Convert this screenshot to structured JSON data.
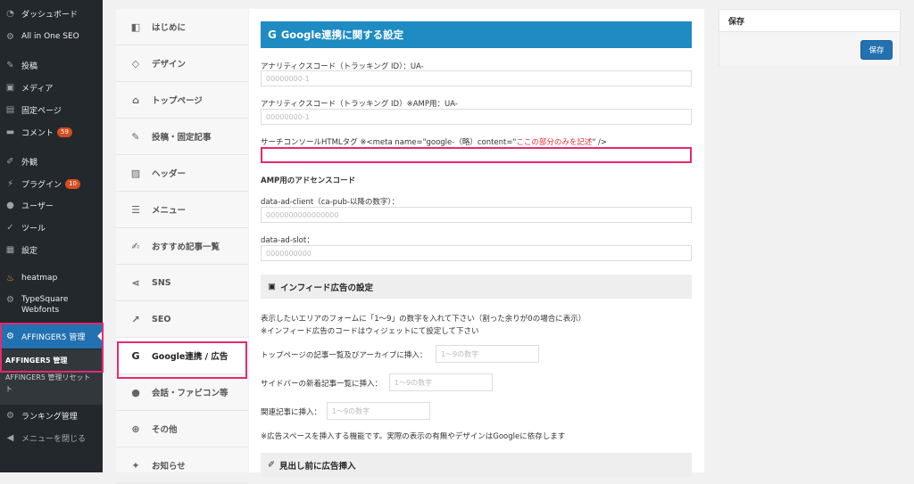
{
  "admin_menu": {
    "items": [
      {
        "label": "ダッシュボード",
        "icon": "dashboard-icon"
      },
      {
        "label": "All in One SEO",
        "icon": "gear-icon"
      },
      {
        "label": "投稿",
        "icon": "pin-icon"
      },
      {
        "label": "メディア",
        "icon": "media-icon"
      },
      {
        "label": "固定ページ",
        "icon": "page-icon"
      },
      {
        "label": "コメント",
        "icon": "comment-icon",
        "badge": "59"
      },
      {
        "label": "外観",
        "icon": "brush-icon"
      },
      {
        "label": "プラグイン",
        "icon": "plugin-icon",
        "badge": "10"
      },
      {
        "label": "ユーザー",
        "icon": "user-icon"
      },
      {
        "label": "ツール",
        "icon": "wrench-icon"
      },
      {
        "label": "設定",
        "icon": "settings-icon"
      },
      {
        "label": "heatmap",
        "icon": "heatmap-icon"
      },
      {
        "label": "TypeSquare",
        "label2": "Webfonts",
        "icon": "gear-icon"
      },
      {
        "label": "AFFINGER5 管理",
        "icon": "gear-icon"
      },
      {
        "label": "ランキング管理",
        "icon": "gear-icon"
      },
      {
        "label": "メニューを閉じる",
        "icon": "collapse-icon"
      }
    ],
    "submenu": {
      "item1": "AFFINGER5 管理",
      "item2": "AFFINGER5 管理リセット",
      "item2b": "ト"
    }
  },
  "tabs": [
    {
      "label": "はじめに",
      "icon": "book-icon"
    },
    {
      "label": "デザイン",
      "icon": "diamond-icon"
    },
    {
      "label": "トップページ",
      "icon": "home-icon"
    },
    {
      "label": "投稿・固定記事",
      "icon": "edit-icon"
    },
    {
      "label": "ヘッダー",
      "icon": "image-icon"
    },
    {
      "label": "メニュー",
      "icon": "menu-icon"
    },
    {
      "label": "おすすめ記事一覧",
      "icon": "edit-square-icon"
    },
    {
      "label": "SNS",
      "icon": "share-icon"
    },
    {
      "label": "SEO",
      "icon": "chart-icon"
    },
    {
      "label": "Google連携 / 広告",
      "icon": "google-icon"
    },
    {
      "label": "会話・ファビコン等",
      "icon": "chat-icon"
    },
    {
      "label": "その他",
      "icon": "plus-circle-icon"
    },
    {
      "label": "お知らせ",
      "icon": "twitter-icon"
    }
  ],
  "main": {
    "title_icon": "G",
    "title": "Google連携に関する設定",
    "analytics_label": "アナリティクスコード（トラッキング ID）：UA-",
    "analytics_placeholder": "00000000-1",
    "analytics_amp_label": "アナリティクスコード（トラッキング ID）※AMP用：UA-",
    "analytics_amp_placeholder": "00000000-1",
    "search_console_label_a": "サーチコンソールHTMLタグ ※<meta name=\"google-（略）content=\"",
    "search_console_label_red": "ここの部分のみを記述",
    "search_console_label_b": "\"   />",
    "amp_adsense_title": "AMP用のアドセンスコード",
    "ad_client_label": "data-ad-client（ca-pub-以降の数字）：",
    "ad_client_placeholder": "0000000000000000",
    "ad_slot_label": "data-ad-slot：",
    "ad_slot_placeholder": "0000000000",
    "infeed_title": "インフィード広告の設定",
    "infeed_desc1": "表示したいエリアのフォームに「1〜9」の数字を入れて下さい（割った余りが0の場合に表示）",
    "infeed_desc2": "※インフィード広告のコードはウィジェットにて設定して下さい",
    "top_insert_label": "トップページの記事一覧及びアーカイブに挿入：",
    "sidebar_insert_label": "サイドバーの新着記事一覧に挿入：",
    "related_insert_label": "関連記事に挿入：",
    "range_placeholder": "1〜9の数字",
    "note": "※広告スペースを挿入する機能です。実際の表示の有無やデザインはGoogleに依存します",
    "heading_ad_title": "見出し前に広告挿入"
  },
  "savebox": {
    "title": "保存",
    "button": "保存"
  },
  "colors": {
    "accent": "#1e8bc3",
    "highlight": "#e72871",
    "admin_bg": "#23282d",
    "wp_blue": "#2271b1"
  }
}
